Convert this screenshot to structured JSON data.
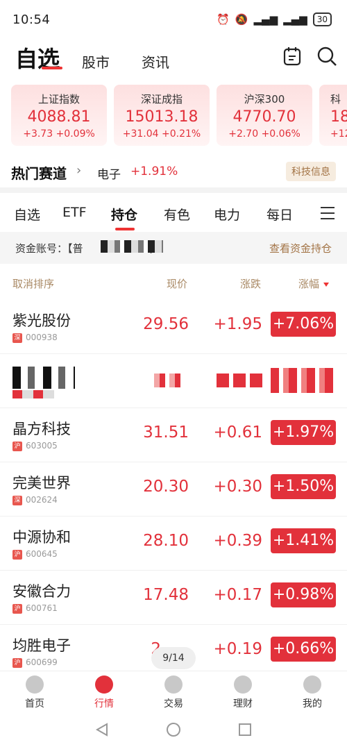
{
  "status": {
    "time": "10:54",
    "battery": "30"
  },
  "header": {
    "title": "自选",
    "tabs": [
      "股市",
      "资讯"
    ]
  },
  "indices": [
    {
      "name": "上证指数",
      "value": "4088.81",
      "change": "+3.73 +0.09%"
    },
    {
      "name": "深证成指",
      "value": "15013.18",
      "change": "+31.04 +0.21%"
    },
    {
      "name": "沪深300",
      "value": "4770.70",
      "change": "+2.70 +0.06%"
    },
    {
      "name": "科",
      "value": "18",
      "change": "+12"
    }
  ],
  "hot": {
    "title": "热门赛道",
    "sector": "电子",
    "pct": "+1.91%",
    "tag": "科技信息"
  },
  "subtabs": [
    "自选",
    "ETF",
    "持仓",
    "有色",
    "电力",
    "每日"
  ],
  "account": {
    "label": "资金账号：【普",
    "suffix": ")",
    "link": "查看资金持仓"
  },
  "columns": {
    "name": "取消排序",
    "price": "现价",
    "change": "涨跌",
    "pct": "涨幅"
  },
  "stocks": [
    {
      "name": "紫光股份",
      "market": "深",
      "code": "000938",
      "price": "29.56",
      "change": "+1.95",
      "pct": "+7.06%"
    },
    {
      "name": "晶方科技",
      "market": "沪",
      "code": "603005",
      "price": "31.51",
      "change": "+0.61",
      "pct": "+1.97%"
    },
    {
      "name": "完美世界",
      "market": "深",
      "code": "002624",
      "price": "20.30",
      "change": "+0.30",
      "pct": "+1.50%"
    },
    {
      "name": "中源协和",
      "market": "沪",
      "code": "600645",
      "price": "28.10",
      "change": "+0.39",
      "pct": "+1.41%"
    },
    {
      "name": "安徽合力",
      "market": "沪",
      "code": "600761",
      "price": "17.48",
      "change": "+0.17",
      "pct": "+0.98%"
    },
    {
      "name": "均胜电子",
      "market": "沪",
      "code": "600699",
      "price": "2",
      "change": "+0.19",
      "pct": "+0.66%"
    }
  ],
  "pager": "9/14",
  "bottom_nav": [
    "首页",
    "行情",
    "交易",
    "理财",
    "我的"
  ],
  "colors": {
    "accent": "#e2313b",
    "gold": "#a37446"
  }
}
